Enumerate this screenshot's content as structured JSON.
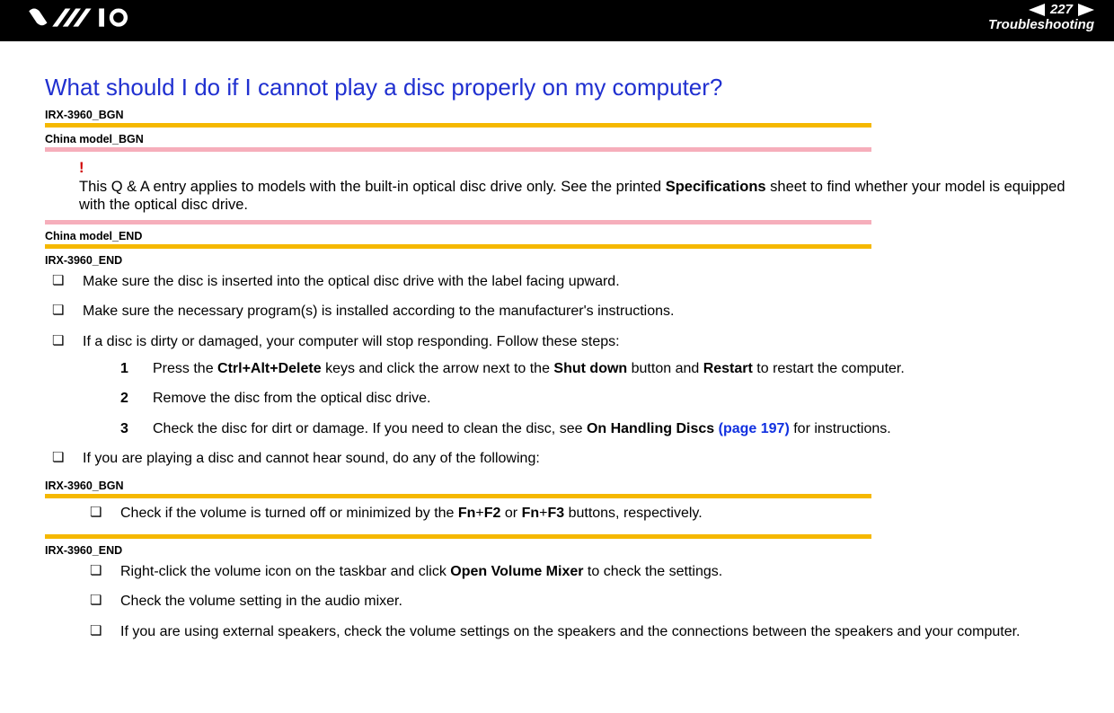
{
  "header": {
    "page_number": "227",
    "section": "Troubleshooting"
  },
  "title": "What should I do if I cannot play a disc properly on my computer?",
  "tags": {
    "irx_bgn": "IRX-3960_BGN",
    "china_bgn": "China model_BGN",
    "china_end": "China model_END",
    "irx_end": "IRX-3960_END",
    "irx_bgn2": "IRX-3960_BGN",
    "irx_end2": "IRX-3960_END"
  },
  "note": {
    "bang": "!",
    "text_pre": "This Q & A entry applies to models with the built-in optical disc drive only. See the printed ",
    "text_bold": "Specifications",
    "text_post": " sheet to find whether your model is equipped with the optical disc drive."
  },
  "bullets": {
    "b1": "Make sure the disc is inserted into the optical disc drive with the label facing upward.",
    "b2": "Make sure the necessary program(s) is installed according to the manufacturer's instructions.",
    "b3": "If a disc is dirty or damaged, your computer will stop responding. Follow these steps:",
    "b4": "If you are playing a disc and cannot hear sound, do any of the following:"
  },
  "steps": {
    "s1": {
      "num": "1",
      "pre": "Press the ",
      "k1": "Ctrl+Alt+Delete",
      "mid1": " keys and click the arrow next to the ",
      "k2": "Shut down",
      "mid2": " button and ",
      "k3": "Restart",
      "post": " to restart the computer."
    },
    "s2": {
      "num": "2",
      "text": "Remove the disc from the optical disc drive."
    },
    "s3": {
      "num": "3",
      "pre": "Check the disc for dirt or damage. If you need to clean the disc, see ",
      "k1": "On Handling Discs",
      "link": " (page 197)",
      "post": " for instructions."
    }
  },
  "sub1": {
    "pre": "Check if the volume is turned off or minimized by the ",
    "k1": "Fn",
    "plus1": "+",
    "k2": "F2",
    "mid": " or ",
    "k3": "Fn",
    "plus2": "+",
    "k4": "F3",
    "post": " buttons, respectively."
  },
  "sub2": {
    "b1_pre": "Right-click the volume icon on the taskbar and click ",
    "b1_bold": "Open Volume Mixer",
    "b1_post": " to check the settings.",
    "b2": "Check the volume setting in the audio mixer.",
    "b3": "If you are using external speakers, check the volume settings on the speakers and the connections between the speakers and your computer."
  }
}
